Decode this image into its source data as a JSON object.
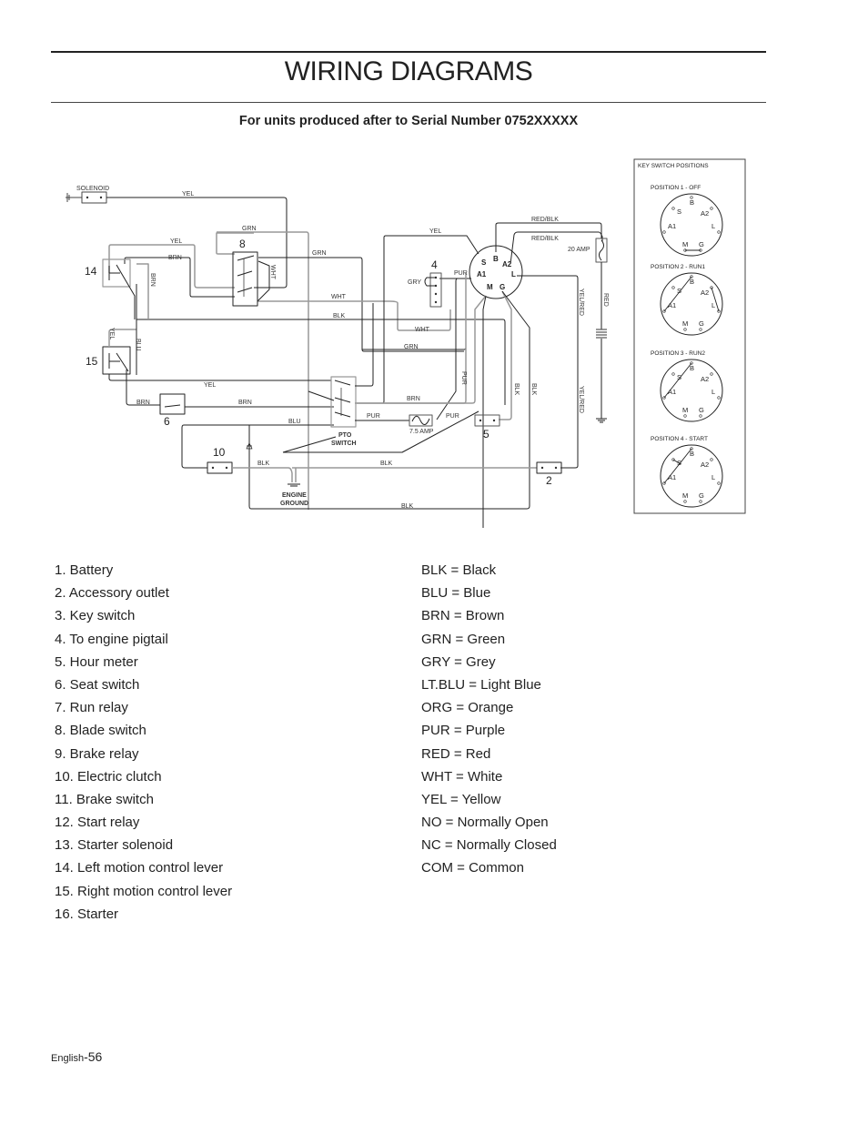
{
  "header": {
    "title": "WIRING DIAGRAMS",
    "subtitle": "For units produced after to Serial Number 0752XXXXX"
  },
  "diagram": {
    "component_labels": {
      "solenoid": "SOLENOID",
      "pto_switch_line1": "PTO",
      "pto_switch_line2": "SWITCH",
      "engine_ground_line1": "ENGINE",
      "engine_ground_line2": "GROUND",
      "fuse_20": "20 AMP",
      "fuse_7_5": "7.5 AMP",
      "gry": "GRY"
    },
    "callouts": {
      "n2": "2",
      "n4": "4",
      "n5": "5",
      "n6": "6",
      "n8": "8",
      "n10": "10",
      "n14": "14",
      "n15": "15"
    },
    "wire_labels": {
      "yel": "YEL",
      "grn": "GRN",
      "brn": "BRN",
      "wht": "WHT",
      "blk": "BLK",
      "blu": "BLU",
      "pur": "PUR",
      "red": "RED",
      "red_blk": "RED/BLK",
      "yel_red": "YEL/RED"
    },
    "key_switch_pins": {
      "s": "S",
      "b": "B",
      "a1": "A1",
      "a2": "A2",
      "l": "L",
      "m": "M",
      "g": "G"
    },
    "key_switch_panel": {
      "title": "KEY SWITCH POSITIONS",
      "positions": [
        {
          "label": "POSITION 1 - OFF"
        },
        {
          "label": "POSITION 2 - RUN1"
        },
        {
          "label": "POSITION 3 - RUN2"
        },
        {
          "label": "POSITION 4 - START"
        }
      ]
    }
  },
  "components_legend": [
    "1. Battery",
    "2. Accessory outlet",
    "3. Key switch",
    "4. To engine pigtail",
    "5. Hour meter",
    "6. Seat switch",
    "7. Run relay",
    "8. Blade switch",
    "9. Brake relay",
    "10. Electric clutch",
    "11. Brake switch",
    "12. Start relay",
    "13. Starter solenoid",
    "14. Left motion control lever",
    "15. Right motion control lever",
    "16. Starter"
  ],
  "color_legend": [
    "BLK = Black",
    "BLU = Blue",
    "BRN = Brown",
    "GRN = Green",
    "GRY = Grey",
    "LT.BLU = Light Blue",
    "ORG = Orange",
    "PUR = Purple",
    "RED = Red",
    "WHT = White",
    "YEL = Yellow",
    "NO = Normally Open",
    "NC = Normally Closed",
    "COM = Common"
  ],
  "footer": {
    "language": "English",
    "page_number": "-56"
  }
}
